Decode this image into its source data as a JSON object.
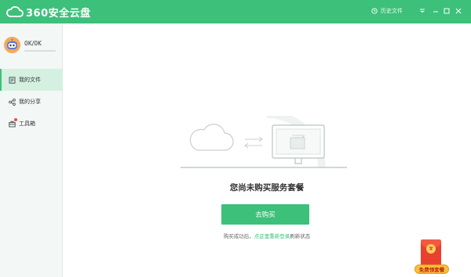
{
  "app": {
    "logo_text": "360安全云盘",
    "history_label": "历史文件"
  },
  "sidebar": {
    "quota_text": "0K/0K",
    "quota_fraction": 0,
    "items": [
      {
        "label": "我的文件",
        "icon": "file-icon",
        "active": true
      },
      {
        "label": "我的分享",
        "icon": "share-icon",
        "active": false
      },
      {
        "label": "工具箱",
        "icon": "toolbox-icon",
        "active": false,
        "badge": true
      }
    ]
  },
  "main": {
    "headline": "您尚未购买服务套餐",
    "buy_button": "去购买",
    "hint_prefix": "购买成功后，",
    "hint_link": "点这里重新登录",
    "hint_suffix": "刷新状态"
  },
  "promo": {
    "label": "免费领套餐"
  },
  "colors": {
    "accent": "#3dc07a",
    "promo_red": "#e8412f",
    "promo_gold": "#f6c23e"
  }
}
